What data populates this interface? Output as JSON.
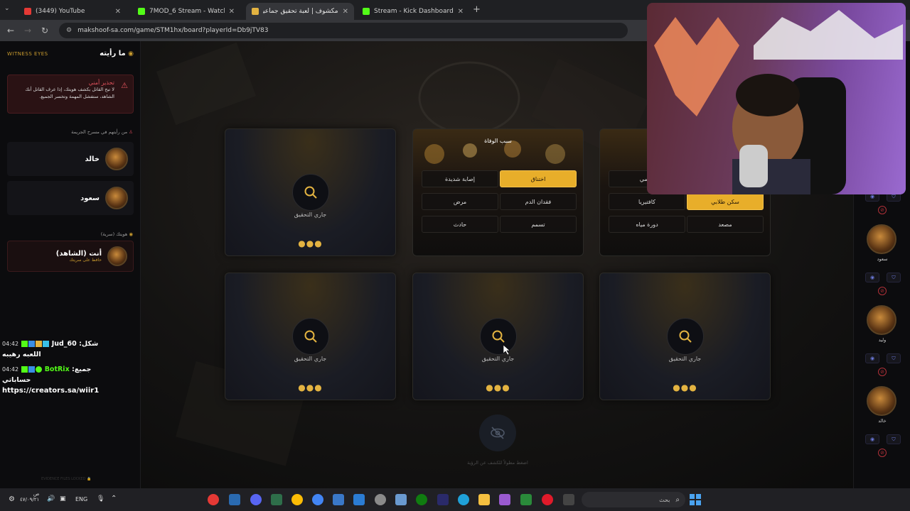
{
  "browser": {
    "tabs": [
      {
        "title": "(3449) YouTube",
        "color": "#e53935",
        "active": false
      },
      {
        "title": "7MOD_6 Stream - Watch Live o",
        "color": "#53fc18",
        "active": false
      },
      {
        "title": "مكشوف | لعبة تحقيق جماعية",
        "color": "#e3b341",
        "active": true
      },
      {
        "title": "Stream - Kick Dashboard",
        "color": "#53fc18",
        "active": false
      }
    ],
    "url": "makshoof-sa.com/game/STM1hx/board?playerId=Db9jTV83"
  },
  "left_panel": {
    "witness_en": "WITNESS EYES",
    "witness_ar": "ما رأيته",
    "warning_title": "تحذير أمني",
    "warning_body": "لا تبح القاتل بكشف هويتك، إذا عرف القاتل أنك الشاهد، ستفشل المهمة وتخسر الجميع.",
    "seen_section": "من رأيتهم في مسرح الجريمة",
    "seen": [
      {
        "name": "خالد"
      },
      {
        "name": "سعود"
      }
    ],
    "identity_section": "هويتك (سرية)",
    "self_name": "أنت (الشاهد)",
    "self_sub": "حافظ على سريتك",
    "footer": "EVIDENCE FILES LOCKED"
  },
  "chat": [
    {
      "time": "04:42",
      "user": "Jud_60",
      "text": "شكل",
      "line2": "اللعبه رهيبه"
    },
    {
      "time": "04:42",
      "user": "BotRix",
      "text": "جميع",
      "line2": "حساباتي"
    },
    {
      "text": "https://creators.sa/wiir1"
    }
  ],
  "board": {
    "investigating_label": "جاري التحقيق",
    "dots": "●●●",
    "cause_card": {
      "title": "سبب الوفاة",
      "options": [
        "إصابة شديدة",
        "اختناق",
        "مرض",
        "فقدان الدم",
        "حادث",
        "تسمم"
      ],
      "selected": "اختناق"
    },
    "weapon_card": {
      "options": [
        "درامي",
        "كافتيريا",
        "سكن طلابي",
        "دورة مياه",
        "مصعد"
      ],
      "selected": "سكن طلابي"
    },
    "reveal_label": "اضغط مطولاً للكشف عن الرؤية"
  },
  "right_rail": {
    "players": [
      {
        "name": "سعود"
      },
      {
        "name": "وليد"
      },
      {
        "name": "خالد"
      }
    ]
  },
  "taskbar": {
    "search": "بحث",
    "lang": "ENG",
    "time": "ص",
    "date": "٤٧/٠٩/٢١"
  }
}
